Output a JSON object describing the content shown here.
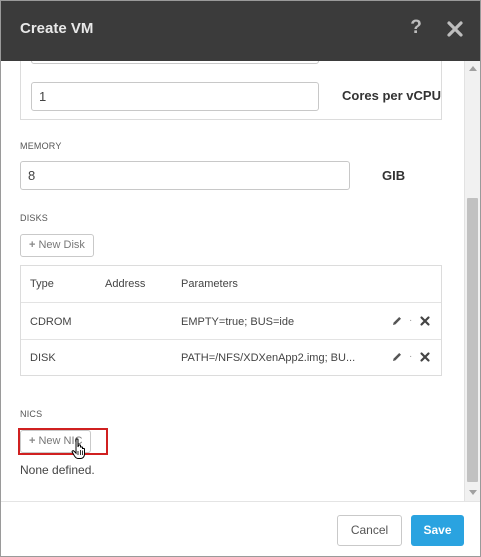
{
  "dialog": {
    "title": "Create VM",
    "help_label": "?"
  },
  "cpu": {
    "top_value": "",
    "cores_value": "1",
    "cores_label": "Cores per vCPU"
  },
  "memory": {
    "section_label": "MEMORY",
    "value": "8",
    "unit_label": "GIB"
  },
  "disks": {
    "section_label": "DISKS",
    "new_button": "New Disk",
    "headers": [
      "Type",
      "Address",
      "Parameters"
    ],
    "rows": [
      {
        "type": "CDROM",
        "address": "",
        "parameters": "EMPTY=true; BUS=ide"
      },
      {
        "type": "DISK",
        "address": "",
        "parameters": "PATH=/NFS/XDXenApp2.img; BU..."
      }
    ]
  },
  "nics": {
    "section_label": "NICS",
    "new_button": "New NIC",
    "empty_text": "None defined."
  },
  "footer": {
    "cancel_label": "Cancel",
    "save_label": "Save"
  },
  "colors": {
    "titlebar": "#3b3b3b",
    "primary": "#2aa3e0",
    "highlight": "#d02020"
  },
  "icons": [
    "help-icon",
    "close-icon",
    "plus-icon",
    "edit-icon",
    "delete-icon",
    "hand-cursor-icon"
  ]
}
